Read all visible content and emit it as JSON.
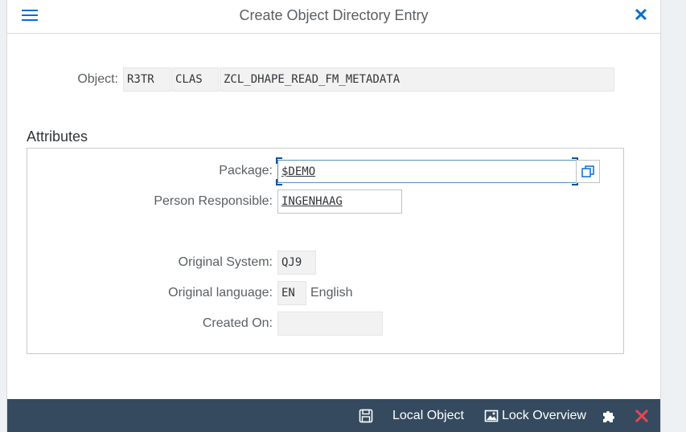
{
  "dialog": {
    "title": "Create Object Directory Entry"
  },
  "object": {
    "label": "Object:",
    "pgmid": "R3TR",
    "type": "CLAS",
    "name": "ZCL_DHAPE_READ_FM_METADATA"
  },
  "attributes": {
    "section_title": "Attributes",
    "package_label": "Package:",
    "package_value": "$DEMO",
    "person_label": "Person Responsible:",
    "person_value": "INGENHAAG",
    "original_system_label": "Original System:",
    "original_system_value": "QJ9",
    "original_language_label": "Original language:",
    "original_language_value": "EN",
    "original_language_text": "English",
    "created_on_label": "Created On:",
    "created_on_value": ""
  },
  "footer": {
    "local_object_label": "Local Object",
    "lock_overview_label": "Lock Overview"
  },
  "colors": {
    "accent": "#0a6ed1",
    "footer_bg": "#354a5f",
    "cancel_red": "#e9454f"
  },
  "icons": [
    "menu-icon",
    "close-icon",
    "value-help-icon",
    "save-icon",
    "image-icon",
    "puzzle-icon",
    "cancel-icon"
  ]
}
